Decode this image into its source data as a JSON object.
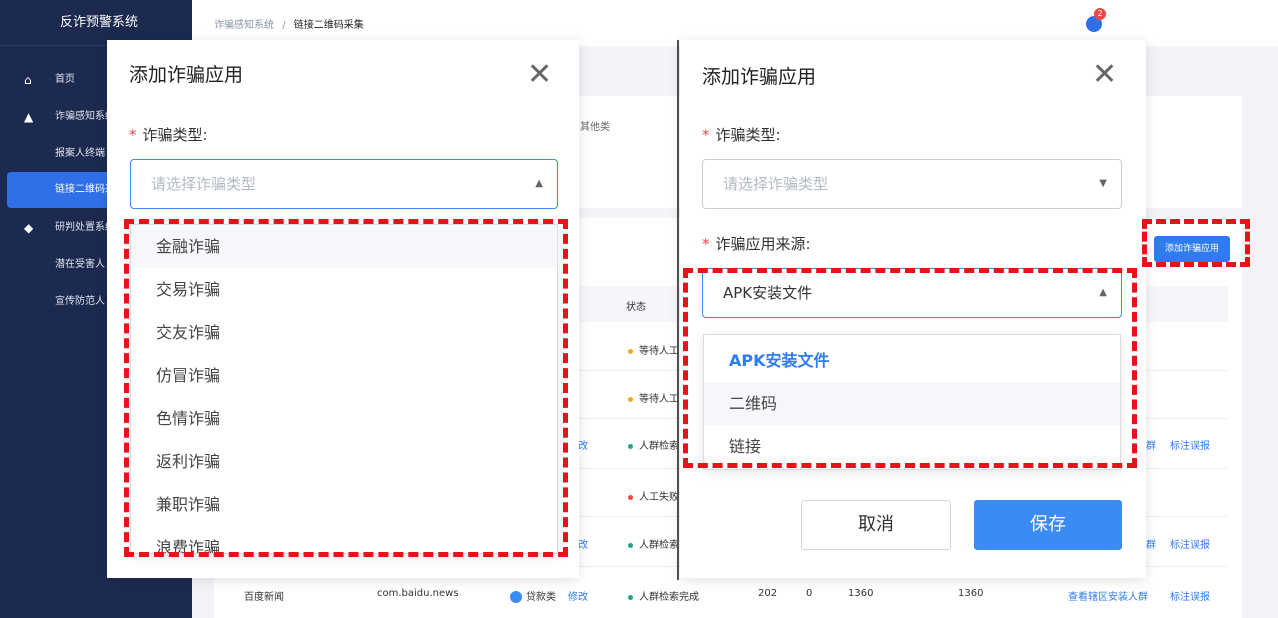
{
  "app": {
    "title": "反诈预警系统",
    "nav": [
      {
        "label": "首页",
        "icon": "home-icon",
        "glyph": "⌂"
      },
      {
        "label": "诈骗感知系统",
        "icon": "system-icon",
        "glyph": "▲"
      },
      {
        "label": "报案人终端",
        "icon": "",
        "glyph": ""
      },
      {
        "label": "链接二维码采集",
        "icon": "",
        "glyph": ""
      },
      {
        "label": "研判处置系统",
        "icon": "graduate-icon",
        "glyph": "◆"
      },
      {
        "label": "潜在受害人",
        "icon": "",
        "glyph": ""
      },
      {
        "label": "宣传防范人",
        "icon": "",
        "glyph": ""
      }
    ],
    "breadcrumb": {
      "parent": "诈骗感知系统",
      "separator": "/",
      "current": "链接二维码采集"
    },
    "notification_count": "2",
    "tab_other": "其他类",
    "add_button": "添加诈骗应用",
    "table_header_status": "状态",
    "rows": [
      {
        "status": "等待人工",
        "status_color": "#f5a623",
        "col5": "",
        "action": ""
      },
      {
        "status": "等待人工",
        "status_color": "#f5a623",
        "col5": "",
        "action": ""
      },
      {
        "status": "人群检索",
        "status_color": "#1ea38a",
        "col5": "改",
        "action": "群"
      },
      {
        "status": "人工失败",
        "status_color": "#f04848",
        "col5": "",
        "action": ""
      },
      {
        "status": "人群检索",
        "status_color": "#1ea38a",
        "col5": "改",
        "action": "群"
      }
    ],
    "actions_mark": "标注误报",
    "last_row": {
      "name": "百度新闻",
      "package": "com.baidu.news",
      "category": "贷款类",
      "edit": "修改",
      "status": "人群检索完成",
      "date": "202",
      "date2": "0",
      "n1": "1360",
      "n2": "1360",
      "view": "查看辖区安装人群",
      "mark": "标注误报"
    }
  },
  "modal_left": {
    "title": "添加诈骗应用",
    "field_label": "诈骗类型:",
    "placeholder": "请选择诈骗类型",
    "options": [
      "金融诈骗",
      "交易诈骗",
      "交友诈骗",
      "仿冒诈骗",
      "色情诈骗",
      "返利诈骗",
      "兼职诈骗",
      "浪费诈骗"
    ]
  },
  "modal_right": {
    "title": "添加诈骗应用",
    "field1_label": "诈骗类型:",
    "field1_placeholder": "请选择诈骗类型",
    "field2_label": "诈骗应用来源:",
    "field2_value": "APK安装文件",
    "options": [
      "APK安装文件",
      "二维码",
      "链接"
    ],
    "cancel": "取消",
    "save": "保存"
  },
  "colors": {
    "accent": "#2f7bf0",
    "sidebar": "#1c2a4f",
    "highlight": "#e8121a"
  }
}
